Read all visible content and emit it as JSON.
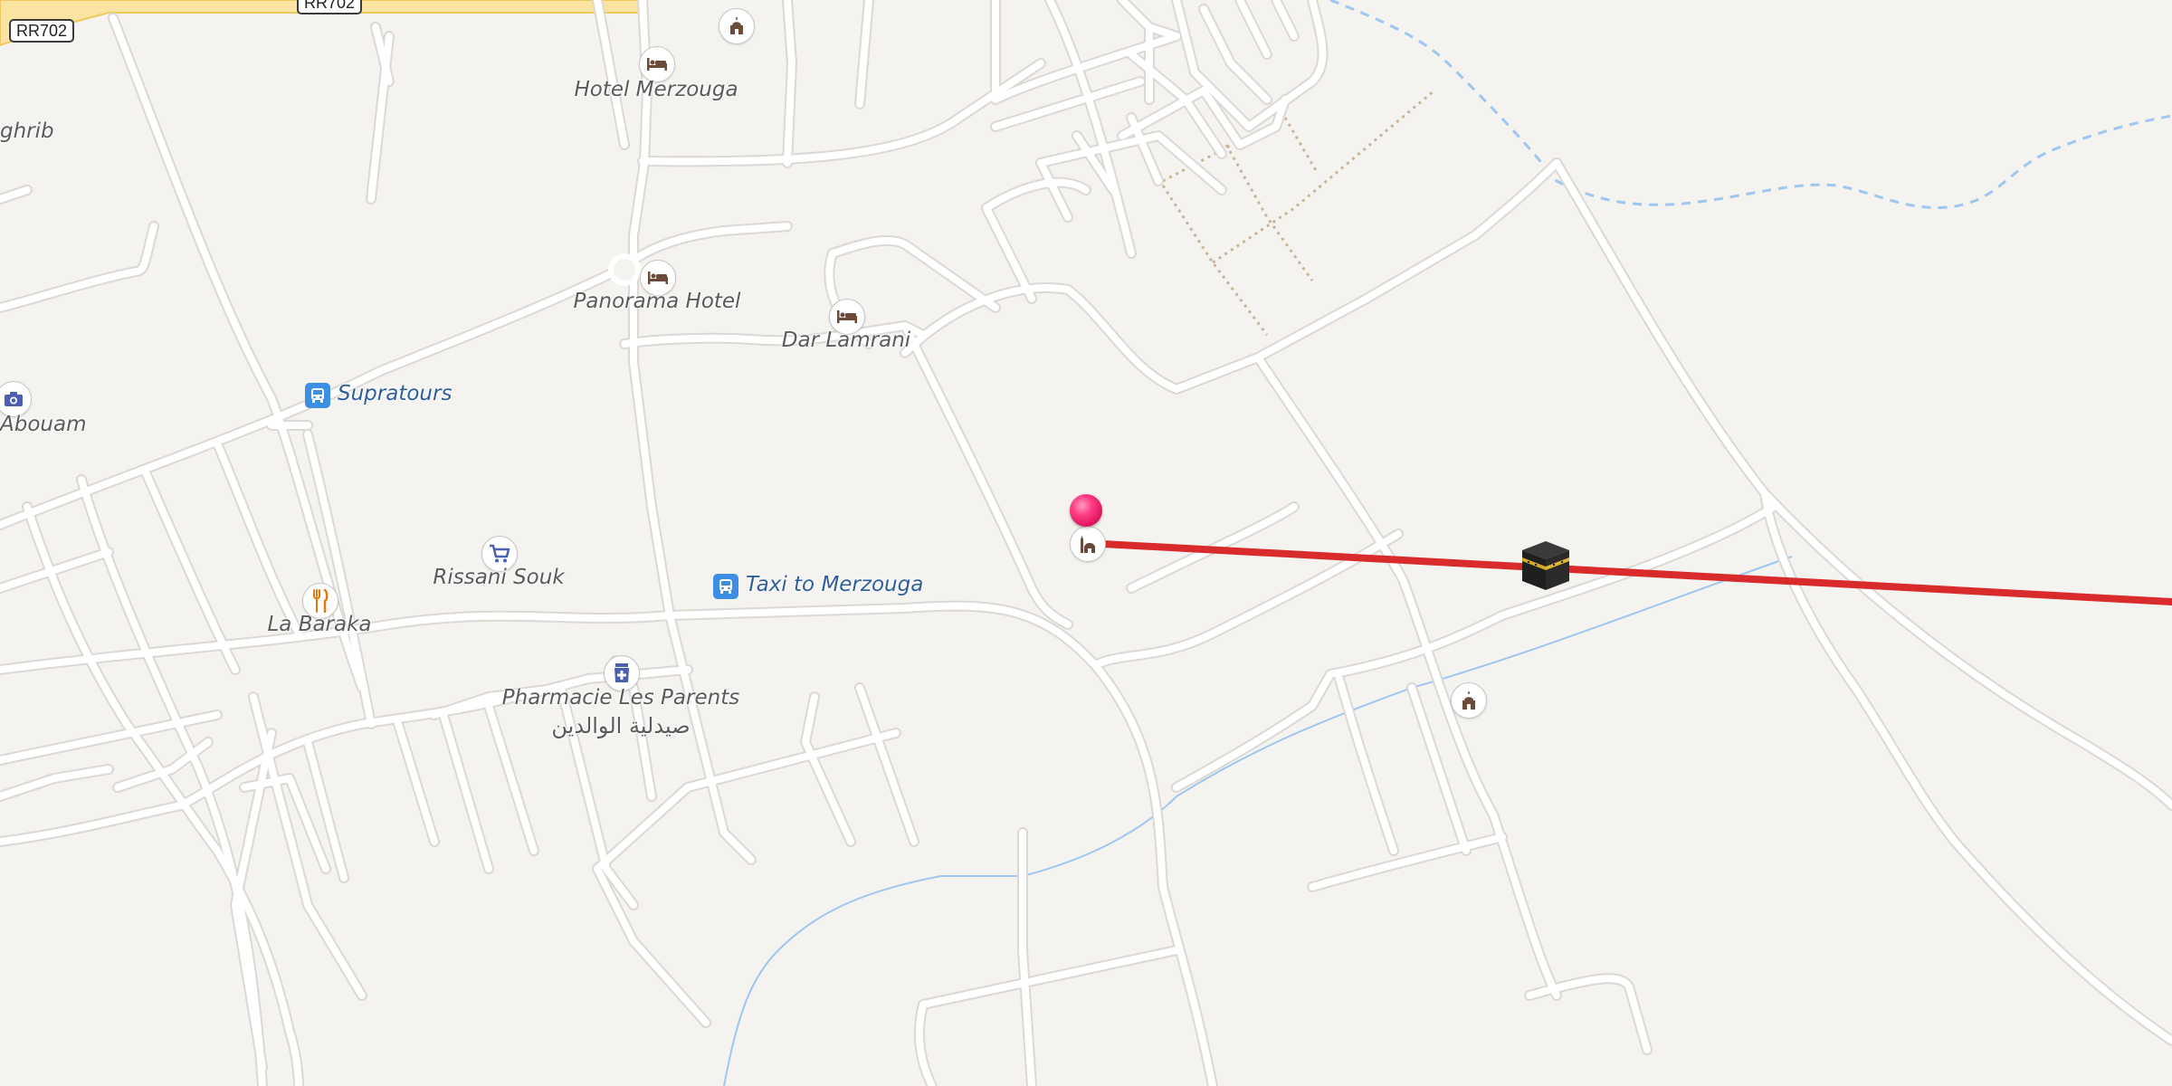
{
  "map": {
    "colors": {
      "background": "#f5f3f0",
      "road": "#ffffff",
      "road_casing": "#dcd8d3",
      "highway": "#fbe3a1",
      "water": "#9fc6ef",
      "path": "#c9b49a",
      "qibla_line": "#d92b2b",
      "pin": "#e8196a",
      "poi_icon": "#6b4a3a",
      "bus_icon": "#3d8fe6"
    },
    "road_shields": [
      "RR702",
      "RR702"
    ],
    "places": {
      "hotel_merzouga": "Hotel Merzouga",
      "panorama_hotel": "Panorama Hotel",
      "dar_lamrani": "Dar Lamrani",
      "supratours": "Supratours",
      "abouam": "Abouam",
      "ghrib": "ghrib",
      "rissani_souk": "Rissani Souk",
      "la_baraka": "La Baraka",
      "taxi_to_merzouga": "Taxi to Merzouga",
      "pharmacie_fr": "Pharmacie Les Parents",
      "pharmacie_ar": "صيدلية الوالدين"
    },
    "icons": {
      "hotel": "bed-icon",
      "mosque": "mosque-icon",
      "bus": "bus-icon",
      "camera": "camera-icon",
      "shop": "shopping-cart-icon",
      "restaurant": "fork-knife-icon",
      "pharmacy": "pharmacy-icon",
      "location": "location-pin-icon",
      "kaaba": "kaaba-icon"
    }
  }
}
